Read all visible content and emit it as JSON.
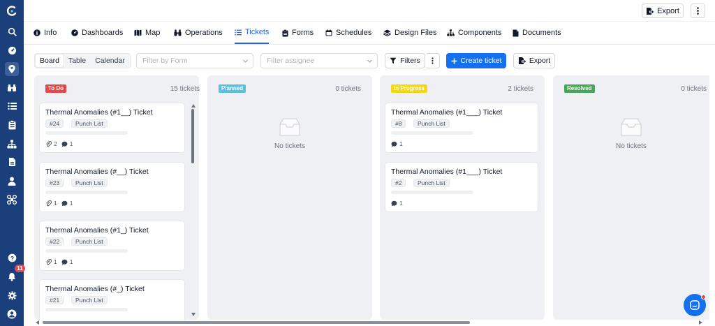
{
  "rail": {
    "icons": [
      "logo-icon",
      "search-icon",
      "dashboard-icon",
      "map-pin-icon",
      "binoculars-icon",
      "list-icon",
      "clipboard-icon",
      "hierarchy-icon",
      "file-icon",
      "user-icon",
      "drone-icon",
      "help-icon",
      "bell-icon",
      "settings-icon",
      "account-icon"
    ],
    "notification_count": "11"
  },
  "topbar": {
    "export_label": "Export"
  },
  "tabs": [
    {
      "label": "Info",
      "icon": "info-icon"
    },
    {
      "label": "Dashboards",
      "icon": "dashboard-icon"
    },
    {
      "label": "Map",
      "icon": "map-icon"
    },
    {
      "label": "Operations",
      "icon": "binoculars-icon"
    },
    {
      "label": "Tickets",
      "icon": "list-icon",
      "active": true
    },
    {
      "label": "Forms",
      "icon": "clipboard-icon"
    },
    {
      "label": "Schedules",
      "icon": "calendar-icon"
    },
    {
      "label": "Design Files",
      "icon": "layers-icon"
    },
    {
      "label": "Components",
      "icon": "hierarchy-icon"
    },
    {
      "label": "Documents",
      "icon": "document-icon"
    }
  ],
  "toolbar": {
    "views": [
      "Board",
      "Table",
      "Calendar"
    ],
    "selected_view": "Board",
    "filter_form_placeholder": "Filter by Form",
    "filter_assignee_placeholder": "Filter assignee",
    "filters_label": "Filters",
    "create_label": "Create ticket",
    "export_label": "Export"
  },
  "colors": {
    "rail": "#1a3f7a",
    "accent": "#1570ef",
    "todo": "#e5484d",
    "planned": "#5bc0de",
    "in_progress": "#f5d90a",
    "resolved": "#46a758"
  },
  "columns": [
    {
      "status": "To Do",
      "count": "15 tickets",
      "tickets": [
        {
          "title": "Thermal Anomalies (#1__) Ticket",
          "number": "#24",
          "tag": "Punch List",
          "attachments": "2",
          "comments": "1"
        },
        {
          "title": "Thermal Anomalies (#__) Ticket",
          "number": "#23",
          "tag": "Punch List",
          "attachments": "1",
          "comments": "1"
        },
        {
          "title": "Thermal Anomalies (#1_) Ticket",
          "number": "#22",
          "tag": "Punch List",
          "attachments": "1",
          "comments": "1"
        },
        {
          "title": "Thermal Anomalies (#_) Ticket",
          "number": "#21",
          "tag": "Punch List"
        }
      ]
    },
    {
      "status": "Planned",
      "count": "0 tickets",
      "empty_text": "No tickets"
    },
    {
      "status": "In Progress",
      "count": "2 tickets",
      "tickets": [
        {
          "title": "Thermal Anomalies (#1___) Ticket",
          "number": "#8",
          "tag": "Punch List",
          "comments": "1"
        },
        {
          "title": "Thermal Anomalies (#1___) Ticket",
          "number": "#2",
          "tag": "Punch List",
          "comments": "1"
        }
      ]
    },
    {
      "status": "Resolved",
      "count": "0 tickets",
      "empty_text": "No tickets"
    }
  ]
}
